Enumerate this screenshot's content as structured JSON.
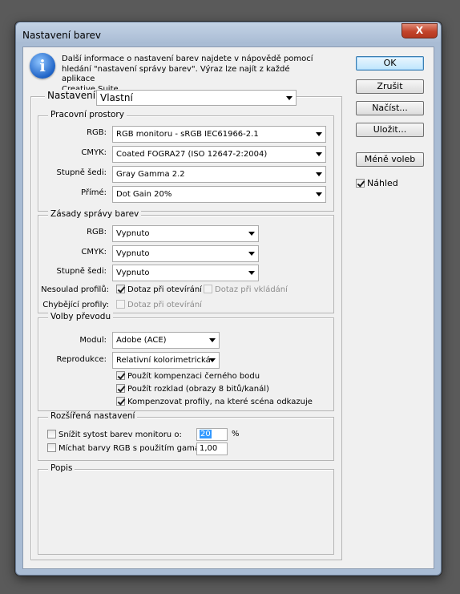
{
  "window": {
    "title": "Nastavení barev",
    "close_symbol": "X"
  },
  "info": {
    "icon_glyph": "i",
    "text": "Další informace o nastavení barev najdete v nápovědě pomocí\nhledání \"nastavení správy barev\". Výraz lze najít z každé aplikace\nCreative Suite."
  },
  "buttons": {
    "ok": "OK",
    "cancel": "Zrušit",
    "load": "Načíst...",
    "save": "Uložit...",
    "fewer_options": "Méně voleb",
    "preview": {
      "label": "Náhled",
      "checked": true
    }
  },
  "settings": {
    "label": "Nastavení:",
    "value": "Vlastní"
  },
  "working_spaces": {
    "title": "Pracovní prostory",
    "rgb": {
      "label": "RGB:",
      "value": "RGB monitoru - sRGB IEC61966-2.1"
    },
    "cmyk": {
      "label": "CMYK:",
      "value": "Coated FOGRA27 (ISO 12647-2:2004)"
    },
    "gray": {
      "label": "Stupně šedi:",
      "value": "Gray Gamma 2.2"
    },
    "spot": {
      "label": "Přímé:",
      "value": "Dot Gain 20%"
    }
  },
  "policies": {
    "title": "Zásady správy barev",
    "rgb": {
      "label": "RGB:",
      "value": "Vypnuto"
    },
    "cmyk": {
      "label": "CMYK:",
      "value": "Vypnuto"
    },
    "gray": {
      "label": "Stupně šedi:",
      "value": "Vypnuto"
    },
    "mismatch_label": "Nesoulad profilů:",
    "ask_open": {
      "label": "Dotaz při otevírání",
      "checked": true
    },
    "ask_paste": {
      "label": "Dotaz při vkládání",
      "checked": false
    },
    "missing_label": "Chybějící profily:",
    "missing_ask_open": {
      "label": "Dotaz při otevírání",
      "checked": false
    }
  },
  "conversion": {
    "title": "Volby převodu",
    "engine": {
      "label": "Modul:",
      "value": "Adobe (ACE)"
    },
    "intent": {
      "label": "Reprodukce:",
      "value": "Relativní kolorimetrická"
    },
    "bpc": {
      "label": "Použít kompenzaci černého bodu",
      "checked": true
    },
    "dither": {
      "label": "Použít rozklad (obrazy 8 bitů/kanál)",
      "checked": true
    },
    "compensate": {
      "label": "Kompenzovat profily, na které scéna odkazuje",
      "checked": true
    }
  },
  "advanced": {
    "title": "Rozšířená nastavení",
    "desaturate": {
      "label": "Snížit sytost barev monitoru o:",
      "checked": false,
      "value": "20",
      "unit": "%"
    },
    "blend": {
      "label": "Míchat barvy RGB s použitím gama:",
      "checked": false,
      "value": "1,00"
    }
  },
  "description": {
    "title": "Popis"
  }
}
